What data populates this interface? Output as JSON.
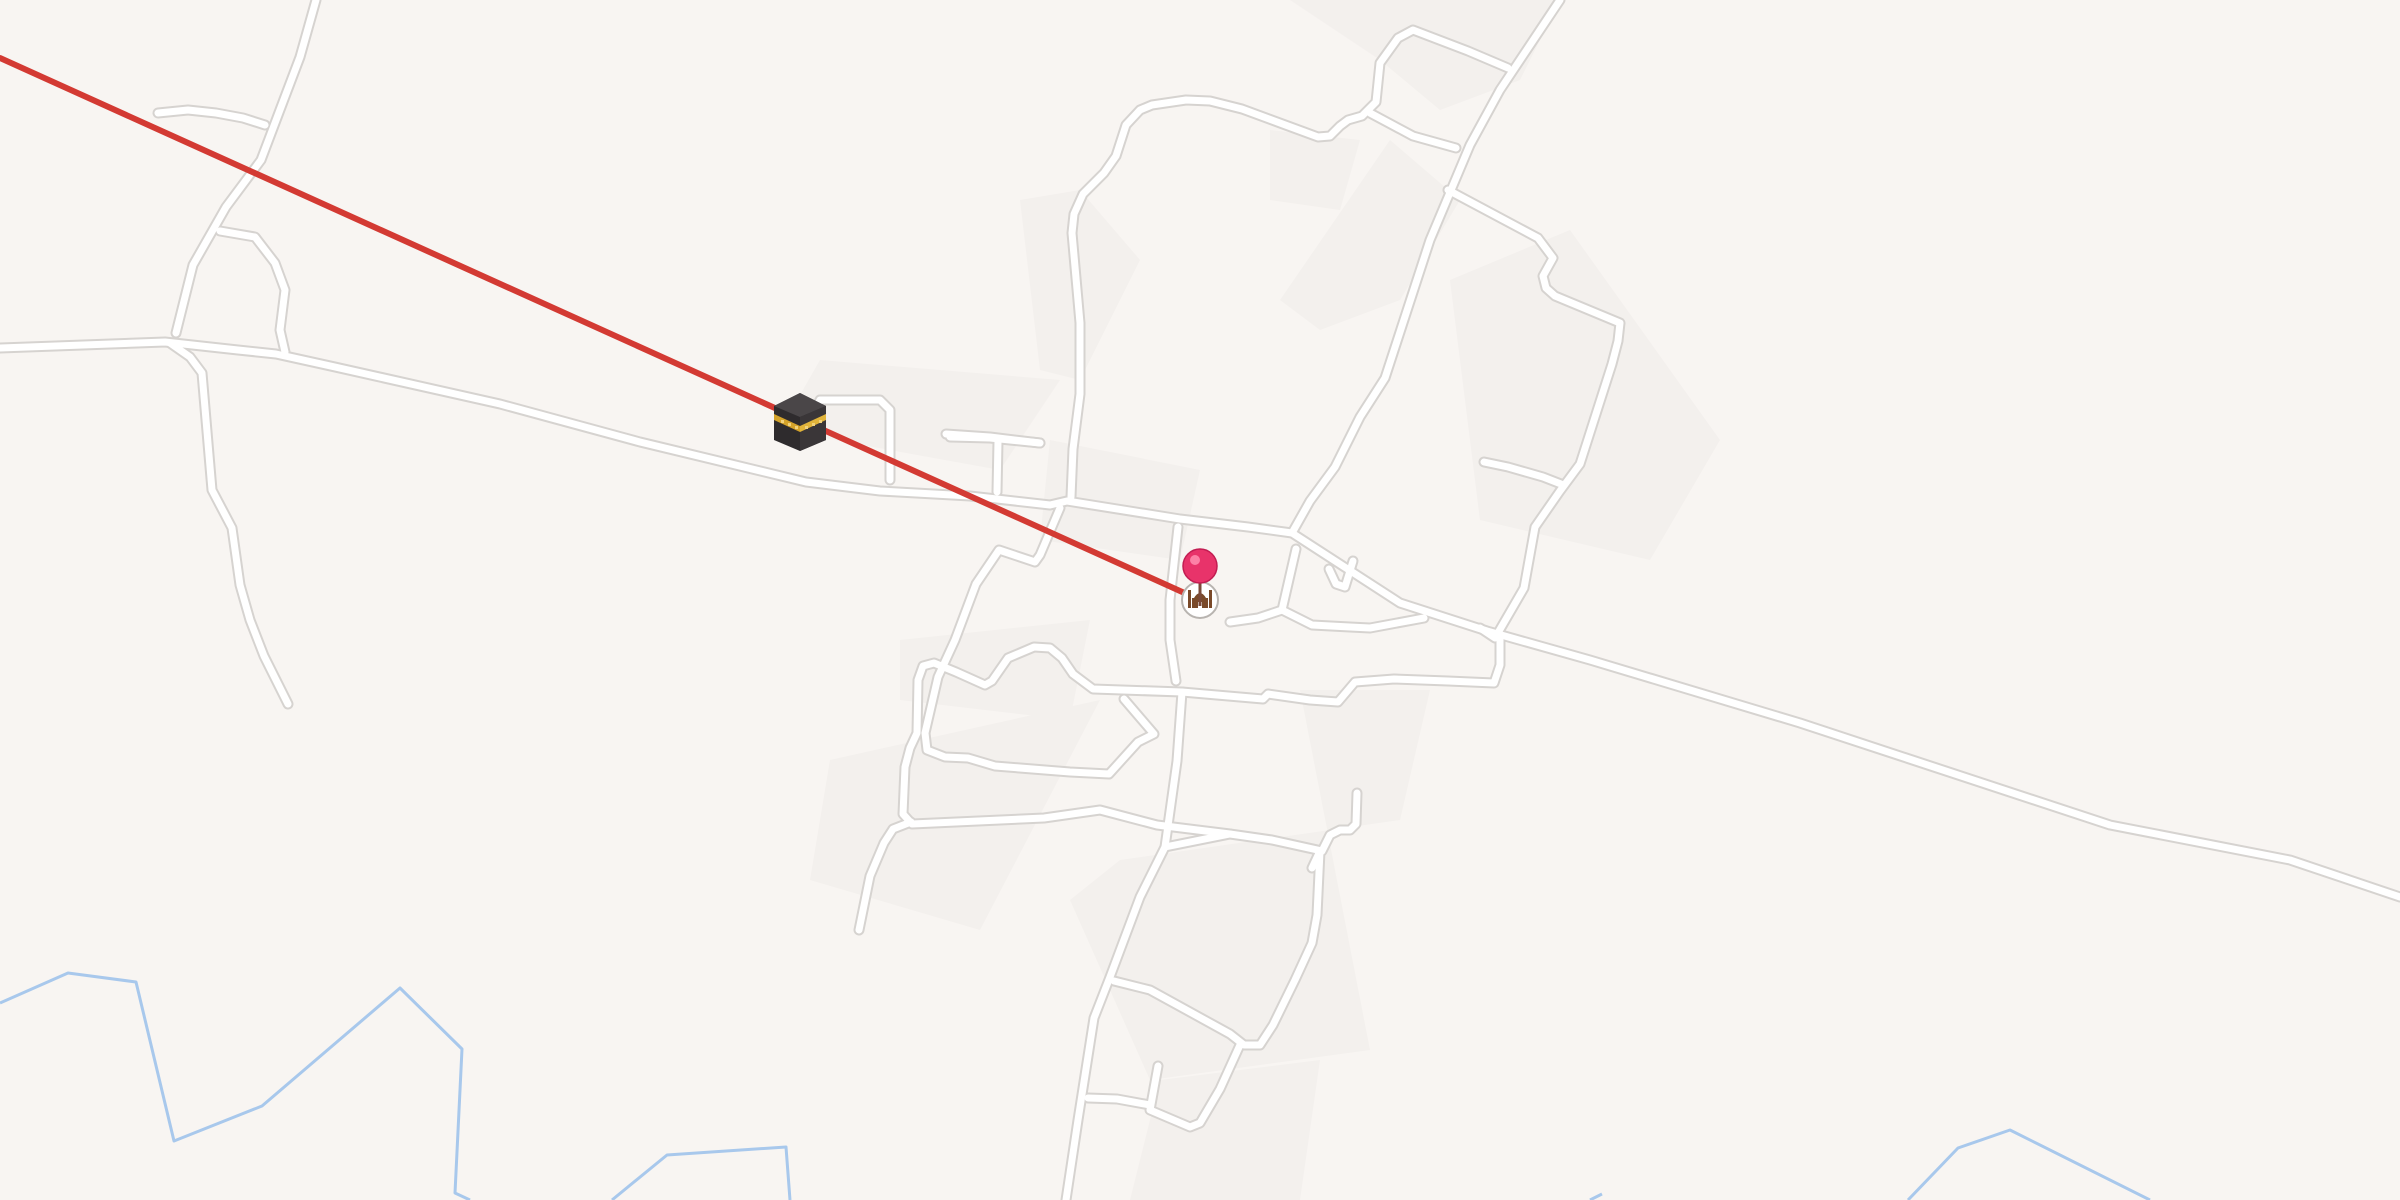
{
  "map": {
    "background_color": "#f8f5f2",
    "landuse_color": "#f3f0ed",
    "road_fill_color": "#ffffff",
    "road_casing_color": "#d9d6d3",
    "waterway_color": "#a8c8ec",
    "route_line_color": "#d33a33",
    "route": {
      "from": "user-location",
      "to": "kaaba",
      "label": ""
    },
    "markers": [
      {
        "kind": "kaaba",
        "icon": "kaaba-icon",
        "label": ""
      },
      {
        "kind": "current-location-pin",
        "icon": "location-pin-icon",
        "color": "#e8336a",
        "label": ""
      },
      {
        "kind": "mosque",
        "icon": "mosque-icon",
        "label": ""
      }
    ]
  }
}
